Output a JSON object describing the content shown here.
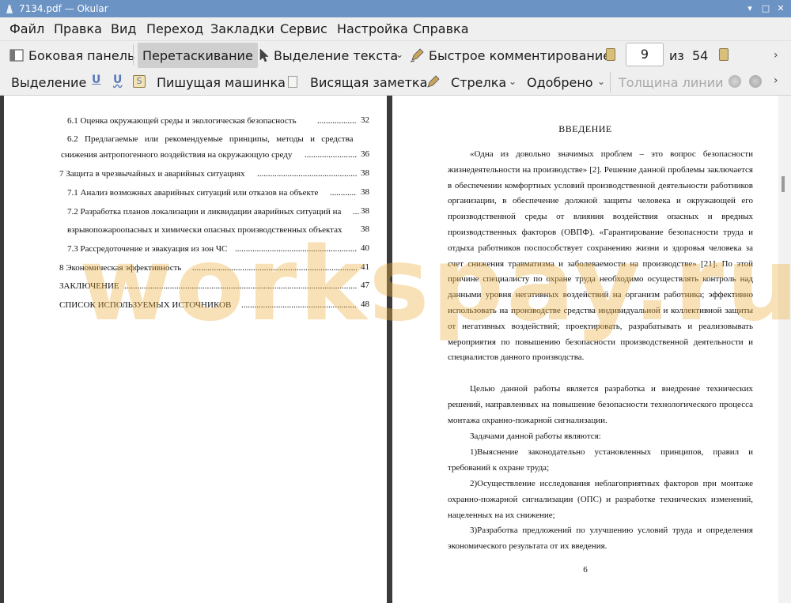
{
  "window": {
    "title": "7134.pdf  — Okular"
  },
  "menu": [
    "Файл",
    "Правка",
    "Вид",
    "Переход",
    "Закладки",
    "Сервис",
    "Настройка",
    "Справка"
  ],
  "toolbar1": {
    "sidebar": "Боковая панель",
    "drag": "Перетаскивание",
    "text_select": "Выделение текста",
    "quick_comment": "Быстрое комментирование",
    "page_current": "9",
    "page_of": "из",
    "page_total": "54"
  },
  "toolbar2": {
    "selection": "Выделение",
    "typewriter": "Пишущая машинка",
    "sticky_note": "Висящая заметка",
    "arrow": "Стрелка",
    "approved": "Одобрено",
    "line_width": "Толщина линии"
  },
  "left_page": {
    "toc": [
      {
        "text": "6.1  Оценка окружающей среды и экологическая безопасность",
        "page": "32"
      },
      {
        "text": "6.2   Предлагаемые   или   рекомендуемые   принципы,   методы   и   средства",
        "page": ""
      },
      {
        "text": "снижения антропогенного воздействия на окружающую среду",
        "page": "36"
      },
      {
        "text": "7  Защита в чрезвычайных и аварийных ситуациях",
        "page": "38"
      },
      {
        "text": "7.1 Анализ возможных аварийных ситуаций или отказов на объекте",
        "page": "38"
      },
      {
        "text": "7.2 Разработка планов локализации и ликвидации аварийных ситуаций на",
        "page": "38"
      },
      {
        "text": "взрывопожароопасных и химически опасных производственных объектах",
        "page": "38"
      },
      {
        "text": "7.3 Рассредоточение и эвакуация из зон ЧС",
        "page": "40"
      },
      {
        "text": "8  Экономическая эффективность",
        "page": "41"
      },
      {
        "text": "ЗАКЛЮЧЕНИЕ",
        "page": "47"
      },
      {
        "text": "СПИСОК ИСПОЛЬЗУЕМЫХ ИСТОЧНИКОВ",
        "page": "48"
      }
    ]
  },
  "right_page": {
    "heading": "ВВЕДЕНИЕ",
    "paragraphs": [
      "«Одна из довольно значимых проблем – это вопрос безопасности жизнедеятельности на производстве» [2]. Решение данной проблемы заключается в обеспечении комфортных условий производственной деятельности работников организации, в обеспечение должной защиты человека и окружающей его производственной среды от влияния воздействия опасных и вредных производственных факторов (ОВПФ). «Гарантирование безопасности труда и отдыха работников поспособствует сохранению жизни и здоровья человека за счет снижения травматизма и заболеваемости на производстве» [21]. По этой причине специалисту по охране труда необходимо осуществлять контроль над данными уровня негативных воздействий на организм работника; эффективно использовать на производстве средства индивидуальной и коллективной защиты от негативных воздействий; проектировать, разрабатывать и реализовывать мероприятия по повышению безопасности производственной деятельности и специалистов данного производства.",
      "Целью данной работы является разработка и внедрение технических решений, направленных на повышение безопасности технологического процесса монтажа охранно-пожарной сигнализации.",
      "Задачами данной работы являются:",
      "1)Выяснение законодательно установленных принципов, правил и требований к охране труда;",
      "2)Осуществление исследования неблагоприятных факторов при монтаже охранно-пожарной сигнализации (ОПС) и разработке технических изменений, нацеленных на их снижение;",
      "3)Разработка предложений по улучшению условий труда и определения экономического результата от их введения."
    ],
    "page_number": "6"
  },
  "watermark": "workspay.ru"
}
